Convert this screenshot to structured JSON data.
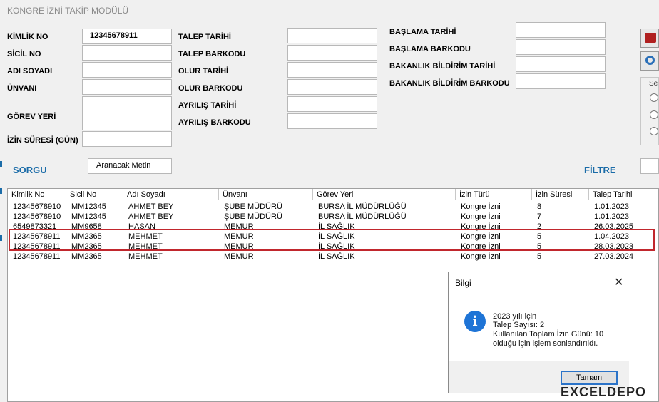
{
  "window": {
    "title": "KONGRE İZNİ TAKİP MODÜLÜ"
  },
  "form": {
    "kimlik_no_label": "KİMLİK NO",
    "kimlik_no_value": "12345678911",
    "sicil_no_label": "SİCİL NO",
    "adi_soyadi_label": "ADI SOYADI",
    "unvani_label": "ÜNVANI",
    "gorev_yeri_label": "GÖREV YERİ",
    "izin_suresi_label": "İZİN SÜRESİ (GÜN)",
    "talep_tarihi_label": "TALEP TARİHİ",
    "talep_barkodu_label": "TALEP BARKODU",
    "olur_tarihi_label": "OLUR TARİHİ",
    "olur_barkodu_label": "OLUR BARKODU",
    "ayrilis_tarihi_label": "AYRILIŞ TARİHİ",
    "ayrilis_barkodu_label": "AYRILIŞ BARKODU",
    "baslama_tarihi_label": "BAŞLAMA TARİHİ",
    "baslama_barkodu_label": "BAŞLAMA BARKODU",
    "bakanlik_tarihi_label": "BAKANLIK BİLDİRİM TARİHİ",
    "bakanlik_barkodu_label": "BAKANLIK BİLDİRİM BARKODU",
    "right_group_label": "Se"
  },
  "query": {
    "sorgu_label": "SORGU",
    "search_value": "Aranacak Metin",
    "filtre_label": "FİLTRE"
  },
  "table": {
    "columns": [
      "Kimlik No",
      "Sicil No",
      "Adı Soyadı",
      "Ünvanı",
      "Görev Yeri",
      "İzin Türü",
      "İzin Süresi",
      "Talep Tarihi"
    ],
    "rows": [
      [
        "12345678910",
        "MM12345",
        "AHMET BEY",
        "ŞUBE MÜDÜRÜ",
        "BURSA İL MÜDÜRLÜĞÜ",
        "Kongre İzni",
        "8",
        "1.01.2023"
      ],
      [
        "12345678910",
        "MM12345",
        "AHMET BEY",
        "ŞUBE MÜDÜRÜ",
        "BURSA İL MÜDÜRLÜĞÜ",
        "Kongre İzni",
        "7",
        "1.01.2023"
      ],
      [
        "6549873321",
        "MM9658",
        "HASAN",
        "MEMUR",
        "İL SAĞLIK",
        "Kongre İzni",
        "2",
        "26.03.2025"
      ],
      [
        "12345678911",
        "MM2365",
        "MEHMET",
        "MEMUR",
        "İL SAĞLIK",
        "Kongre İzni",
        "5",
        "1.04.2023"
      ],
      [
        "12345678911",
        "MM2365",
        "MEHMET",
        "MEMUR",
        "İL SAĞLIK",
        "Kongre İzni",
        "5",
        "28.03.2023"
      ],
      [
        "12345678911",
        "MM2365",
        "MEHMET",
        "MEMUR",
        "İL SAĞLIK",
        "Kongre İzni",
        "5",
        "27.03.2024"
      ]
    ]
  },
  "dialog": {
    "title": "Bilgi",
    "close_icon": "close-icon",
    "info_icon": "info-icon",
    "info_glyph": "i",
    "lines": [
      "2023 yılı için",
      "Talep Sayısı: 2",
      "Kullanılan Toplam İzin Günü: 10",
      "olduğu için işlem sonlandırıldı."
    ],
    "ok_label": "Tamam"
  },
  "watermark": {
    "text": "EXCELDEPO"
  },
  "colors": {
    "accent": "#1b6ca8",
    "highlight": "#c1272d",
    "info": "#1e74d6"
  }
}
